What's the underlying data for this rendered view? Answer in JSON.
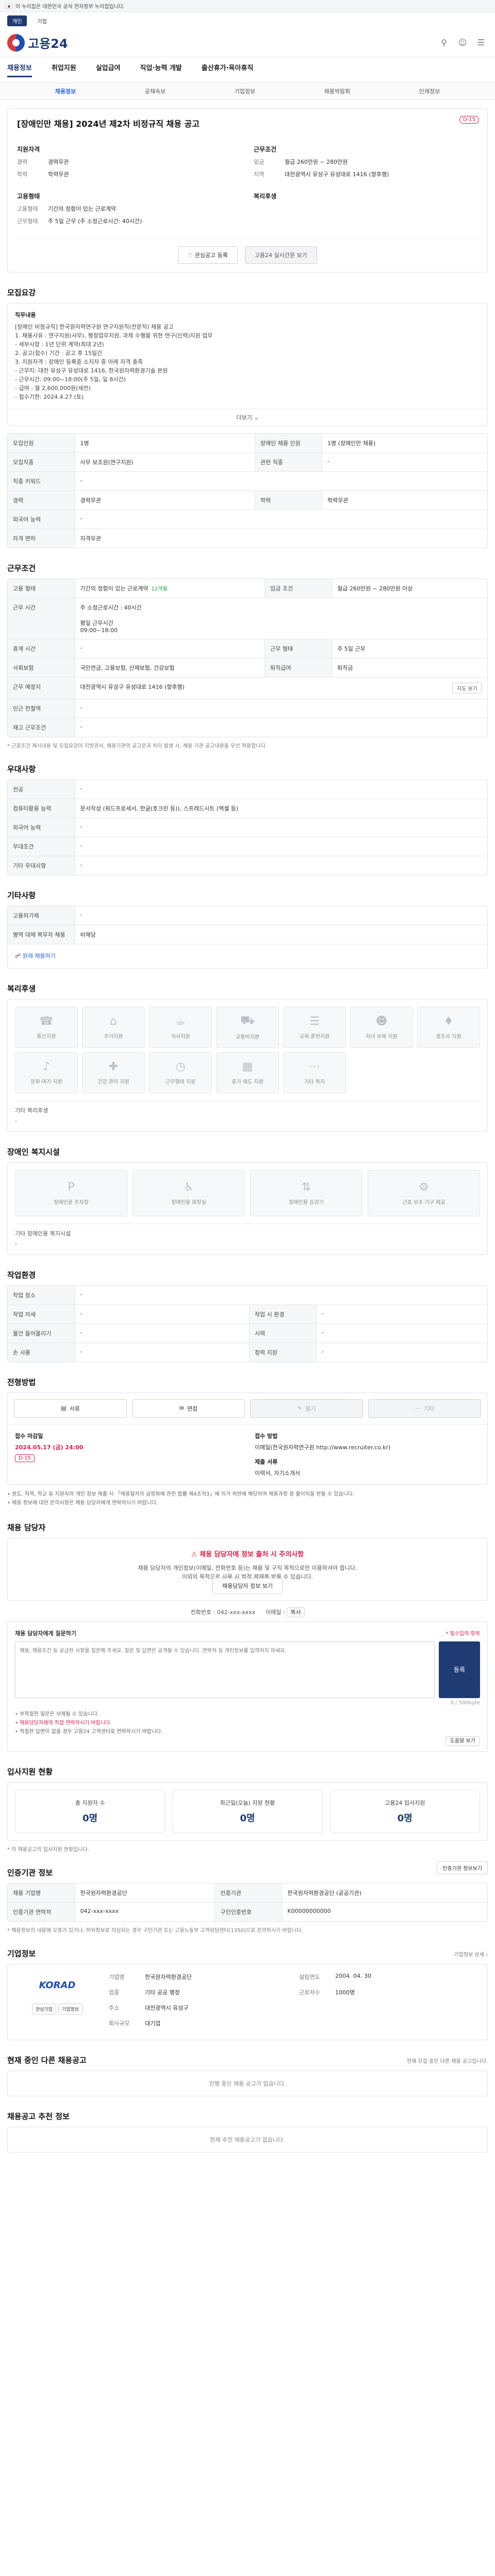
{
  "topbar": {
    "text": "이 누리집은 대한민국 공식 전자정부 누리집입니다.",
    "link": ""
  },
  "lang_tabs": [
    "개인",
    "기업"
  ],
  "site": {
    "name": "고용24"
  },
  "gnb": [
    "채용정보",
    "취업지원",
    "실업급여",
    "직업·능력 개발",
    "출산휴가·육아휴직"
  ],
  "lnb": [
    "채용정보",
    "공채속보",
    "기업정보",
    "채용박람회",
    "인재정보"
  ],
  "job": {
    "badge": "D-15",
    "title": "[장애인만 채용] 2024년 제2차 비정규직 채용 공고",
    "qual_h": "지원자격",
    "career_k": "경력",
    "career_v": "경력무관",
    "edu_k": "학력",
    "edu_v": "학력무관",
    "cond_h": "근무조건",
    "wage_k": "임금",
    "wage_v": "월급 260만원 ~ 280만원",
    "region_k": "지역",
    "region_v": "대전광역시 유성구 유성대로 1416 (향후행)",
    "form_h": "고용형태",
    "form_k": "고용형태",
    "form_v": "기간의 정함이 있는 근로계약",
    "hours_k": "근무형태",
    "hours_v": "주 5일 근무 (주 소정근로시간: 40시간)",
    "wel_h": "복리후생",
    "btn_interest": "관심공고 등록",
    "btn_share": "고용24 실시간문 보기"
  },
  "duty": {
    "title": "모집요강",
    "h": "직무내용",
    "lines": [
      "[장애인 비정규직] 한국원자력연구원 연구지원직(전문직) 채용 공고",
      "1. 채용사유 : 연구지원(사무), 행정업무지원, 과제 수행을 위한 연구(인력)지원 업무",
      "  - 세부사항 : 1년 단위 계약(최대 2년)",
      "2. 공고(접수) 기간 : 공고 후 15일간",
      "3. 지원자격 : 장애인 등록증 소지자 중 아래 자격 충족",
      "  - 근무지: 대전 유성구 유성대로 1416, 한국원자력환경기술 본원",
      "  - 근무시간: 09:00~18:00(주 5일, 일 8시간)",
      "  - 급여 : 월 2,600,000원(세전)",
      "  - 접수기한: 2024.4.27.(토)"
    ],
    "more": "더보기"
  },
  "recruit_table": {
    "r1": [
      "모집인원",
      "1명",
      "장애인 채용 인원",
      "1명 (장애인만 채용)"
    ],
    "r2": [
      "모집직종",
      "사무 보조원(연구지원)",
      "관련 직종",
      "-"
    ],
    "r3": [
      "직종 키워드",
      "-"
    ],
    "r4": [
      "경력",
      "경력무관",
      "학력",
      "학력무관"
    ],
    "r5": [
      "외국어 능력",
      "-"
    ],
    "r6": [
      "자격 면허",
      "자격무관"
    ]
  },
  "work": {
    "title": "근무조건",
    "type_k": "고용 형태",
    "type_v": "기간의 정함이 있는 근로계약",
    "type_tag": "12개월",
    "wage_k": "임금 조건",
    "wage_v": "월급 260만원 ~ 280만원 이상",
    "time_k": "근무 시간",
    "time_v1": "주 소정근로시간 : 40시간",
    "time_v2": "평일 근무시간",
    "time_v3": "09:00~18:00",
    "week_k": "휴게 시간",
    "week_v": "-",
    "shift_k": "근무 형태",
    "shift_v": "주 5일 근무",
    "social_k": "사회보험",
    "social_v": "국민연금, 고용보험, 산재보험, 건강보험",
    "retire_k": "퇴직급여",
    "retire_v": "퇴직금",
    "place_k": "근무 예정지",
    "place_v": "대전광역시 유성구 유성대로 1416 (향후행)",
    "place_btn": "지도 보기",
    "near_k": "인근 전철역",
    "near_v": "-",
    "chk_k": "재고 근무조건",
    "chk_v": "-",
    "note": "* 근로조건 제시내용 및 모집요강이 지방관서, 채용기관의 공고문과 차이 발생 시, 채용 기관 공고내용을 우선 적용합니다."
  },
  "pref": {
    "title": "우대사항",
    "rows": [
      [
        "전공",
        "-"
      ],
      [
        "컴퓨터활용 능력",
        "문서작성 (워드프로세서, 한글(호크린 등)), 스프레드시트 (엑셀 등)"
      ],
      [
        "외국어 능력",
        "-"
      ],
      [
        "우대조건",
        "-"
      ],
      [
        "기타 우대사항",
        "-"
      ]
    ]
  },
  "other": {
    "title": "기타사항",
    "rows": [
      [
        "고용허가제",
        "-"
      ],
      [
        "병역 대체 복무자 채용",
        "비해당"
      ]
    ],
    "link": "원래 채용하기"
  },
  "welfare": {
    "title": "복리후생",
    "items": [
      "통신지원",
      "주거지원",
      "식사지원",
      "교통비지원",
      "교육·훈련지원",
      "자녀 보육 지원",
      "경조사 지원",
      "문화·여가 지원",
      "건강 관리 지원",
      "근무형태 지원",
      "휴가 제도 지원",
      "기타 복지"
    ],
    "other_k": "기타 복리후생",
    "other_v": "-"
  },
  "disab": {
    "title": "장애인 복지시설",
    "items": [
      "장애인용 주차장",
      "장애인용 화장실",
      "장애인용 승강기",
      "근로 보조 기구 제공"
    ],
    "other_k": "기타 장애인용 복지시설",
    "other_v": "-"
  },
  "env": {
    "title": "작업환경",
    "rows": [
      [
        "작업 장소",
        "-",
        "",
        ""
      ],
      [
        "작업 자세",
        "-",
        "작업 시 환경",
        "-"
      ],
      [
        "물건 들어올리기",
        "-",
        "시력",
        "-"
      ],
      [
        "손 사용",
        "-",
        "청력 지원",
        "-"
      ]
    ]
  },
  "apply": {
    "title": "전형방법",
    "methods": [
      "서류",
      "면접",
      "필기",
      "기타"
    ],
    "deadline_lbl": "접수 마감일",
    "deadline": "2024.05.17 (금) 24:00",
    "dday": "D-15",
    "method_lbl": "접수 방법",
    "method_v": "이메일(한국원자력연구원 http://www.recruiter.co.kr)",
    "docs_lbl": "제출 서류",
    "docs_v": "이력서, 자기소개서",
    "bullets": [
      "• 원도, 직역, 학교 등 지원자의 개인 정보 제출 시 「채용절차의 공정화에 관한 법률 제4조의3」에 의거 위반에 해당하며 채용과정 중 불이익을 받을 수 있습니다.",
      "• 채용 정보에 대한 문의사항은 채용 담당자에게 연락하시기 바랍니다."
    ]
  },
  "contact": {
    "title": "채용 담당자",
    "warn": "채용 담당자에 정보 출처 시 주의사항",
    "desc1": "채용 담당자의 개인정보(이메일, 전화번호 등)는 채용 및 구직 목적으로만 이용하셔야 합니다.",
    "desc2": "이외의 목적으로 사용 시 법적 제재를 받을 수 있습니다.",
    "btn": "채용담당자 정보 보기",
    "phone_k": "전화번호",
    "phone_v": "042-xxx-xxxx",
    "email_k": "이메일",
    "email_v": "복사"
  },
  "inquiry": {
    "title": "채용 담당자에게 질문하기",
    "req": "* 필수입력 항목",
    "placeholder": "채용, 채용조건 등 궁금한 사항을 질문해 주세요. 질문 및 답변은 공개될 수 있습니다. 연락처 등 개인정보를 입력하지 마세요.",
    "send": "등록",
    "count": "0 / 500byte",
    "bullet1": "• 부적절한 질문은 삭제될 수 있습니다.",
    "bullet2": "• 채용담당자에게 직접 연락하시기 바랍니다.",
    "bullet3": "• 적절한 답변이 없을 경우 고용24 고객센터로 연락하시기 바랍니다.",
    "help": "도움말 보기"
  },
  "stats": {
    "title": "입사지원 현황",
    "items": [
      [
        "총 지원자 수",
        "0명"
      ],
      [
        "최근일(오늘) 지원 현황",
        "0명"
      ],
      [
        "고용24 입사지원",
        "0명"
      ]
    ],
    "note": "* 이 채용공고의 입사지원 현황입니다."
  },
  "jobinfo": {
    "title": "인증기관 정보",
    "btn": "인증기관 정보보기",
    "rows": [
      [
        "채용 기업명",
        "한국원자력환경공단",
        "인증기관",
        "한국원자력환경공단 (공공기관)"
      ],
      [
        "인증기관 연락처",
        "042-xxx-xxxx",
        "구인인증번호",
        "K00000000000"
      ]
    ],
    "note": "* 채용정보의 내용에 오류가 있거나, 허위정보로 의심되는 경우 구인기관 또는 고용노동부 고객상담센터(1350)으로 문의하시기 바랍니다."
  },
  "company": {
    "title": "기업정보",
    "more": "기업정보 상세",
    "logo": "KORAD",
    "btn1": "관심기업",
    "btn2": "기업정보",
    "rows": [
      [
        "기업명",
        "한국원자력환경공단"
      ],
      [
        "설립연도",
        "2004. 04. 30"
      ],
      [
        "업종",
        "기타 공공 행정"
      ],
      [
        "근로자수",
        "1000명"
      ],
      [
        "주소",
        "대전광역시 유성구"
      ],
      [
        "",
        ""
      ],
      [
        "회사규모",
        "대기업"
      ],
      [
        "",
        ""
      ]
    ]
  },
  "similar": {
    "title": "현재 중인 다른 채용공고",
    "side": "현재 모집 중인 다른 채용 공고입니다.",
    "empty": "진행 중인 채용 공고가 없습니다."
  },
  "recommend": {
    "title": "채용공고 추천 정보",
    "empty": "현재 추천 채용공고가 없습니다."
  }
}
